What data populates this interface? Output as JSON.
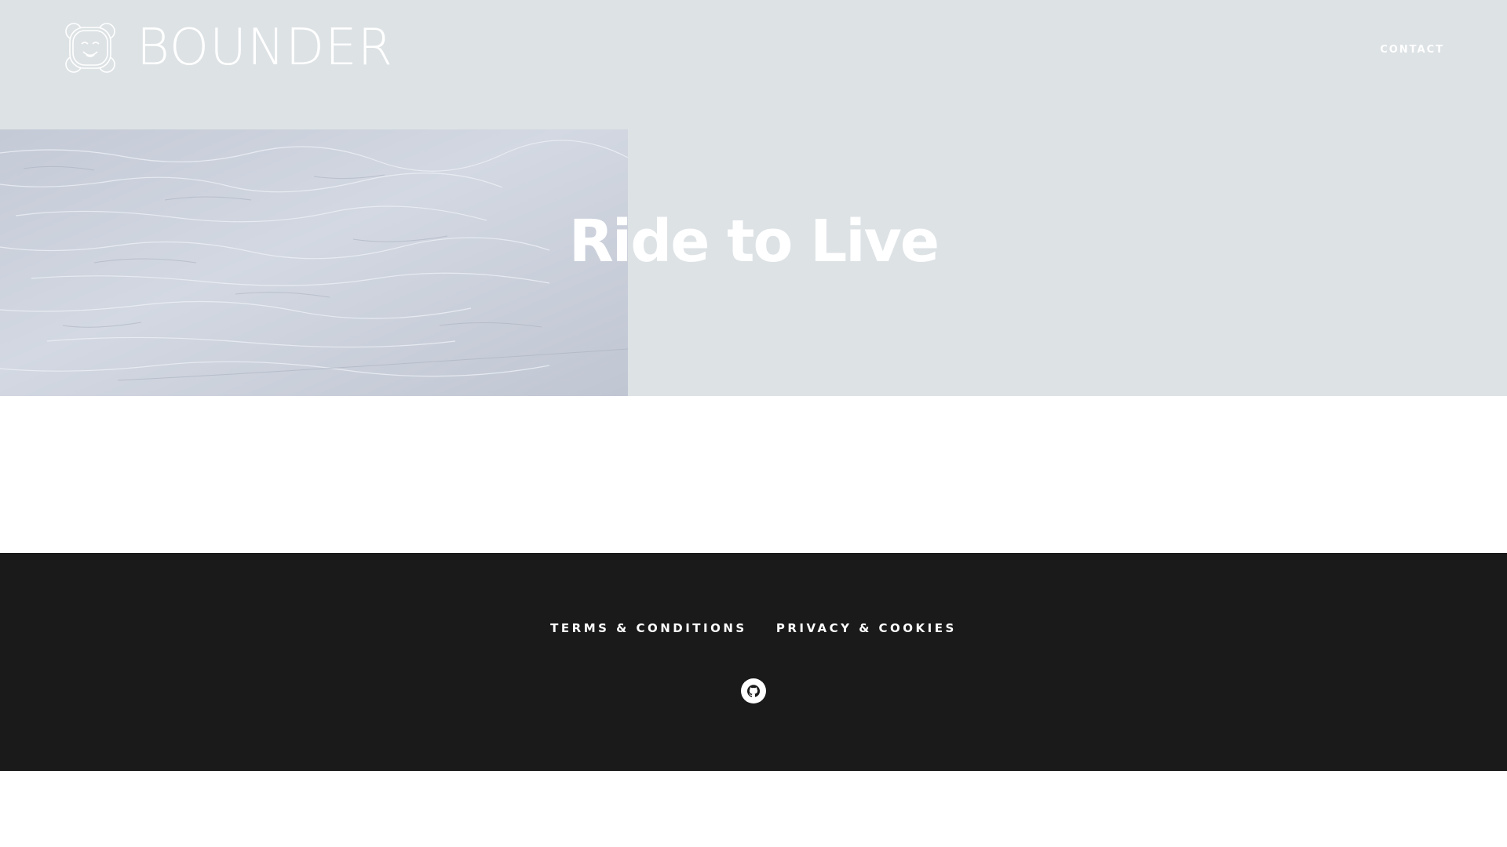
{
  "header": {
    "brand": "BOUNDER",
    "nav": [
      {
        "label": "CONTACT"
      }
    ]
  },
  "hero": {
    "title": "Ride to Live"
  },
  "footer": {
    "links": [
      {
        "label": "TERMS & CONDITIONS"
      },
      {
        "label": "PRIVACY & COOKIES"
      }
    ],
    "social": [
      {
        "icon": "github-icon"
      }
    ]
  },
  "colors": {
    "header_bg": "#dde2e5",
    "footer_bg": "#1a1a1a",
    "text_light": "#ffffff"
  }
}
